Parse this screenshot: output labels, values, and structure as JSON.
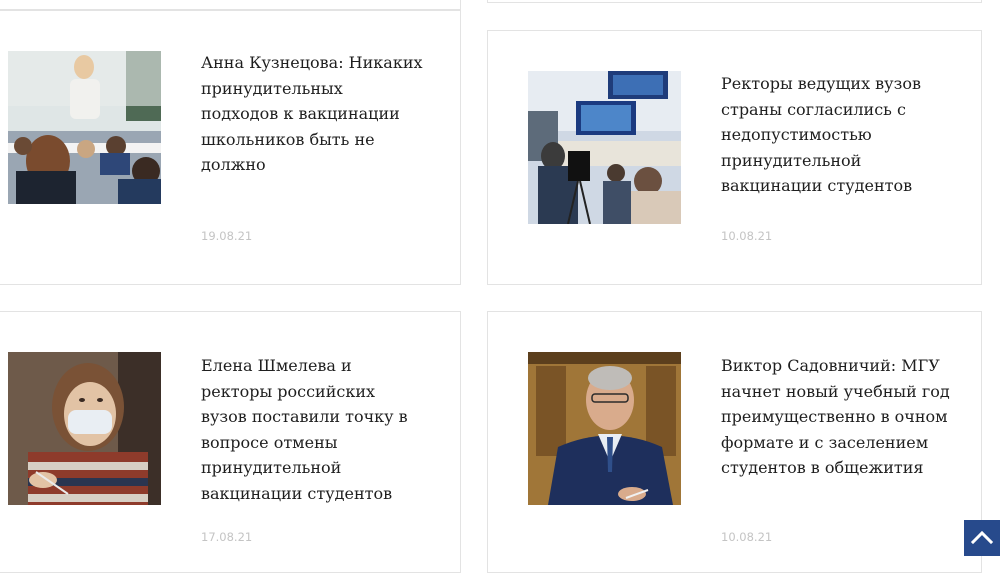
{
  "news": [
    {
      "title": "Анна Кузнецова: Никаких принудительных подходов к вакцинации школьников быть не должно",
      "date": "19.08.21",
      "image": "classroom-photo"
    },
    {
      "title": "Ректоры ведущих вузов страны согласились с недопустимостью принудительной вакцинации студентов",
      "date": "10.08.21",
      "image": "conference-room-photo"
    },
    {
      "title": "Елена Шмелева и ректоры российских вузов поставили точку в вопросе отмены принудительной вакцинации студентов",
      "date": "17.08.21",
      "image": "masked-student-photo"
    },
    {
      "title": "Виктор Садовничий: МГУ начнет новый учебный год преимущественно в очном формате и с заселением студентов в общежития",
      "date": "10.08.21",
      "image": "rector-portrait-photo"
    }
  ],
  "scroll_top": {
    "icon": "chevron-up-icon"
  },
  "colors": {
    "accent": "#274a8c",
    "border": "#e3e3e3",
    "date": "#c4c4c4",
    "text": "#1f1f1f"
  }
}
